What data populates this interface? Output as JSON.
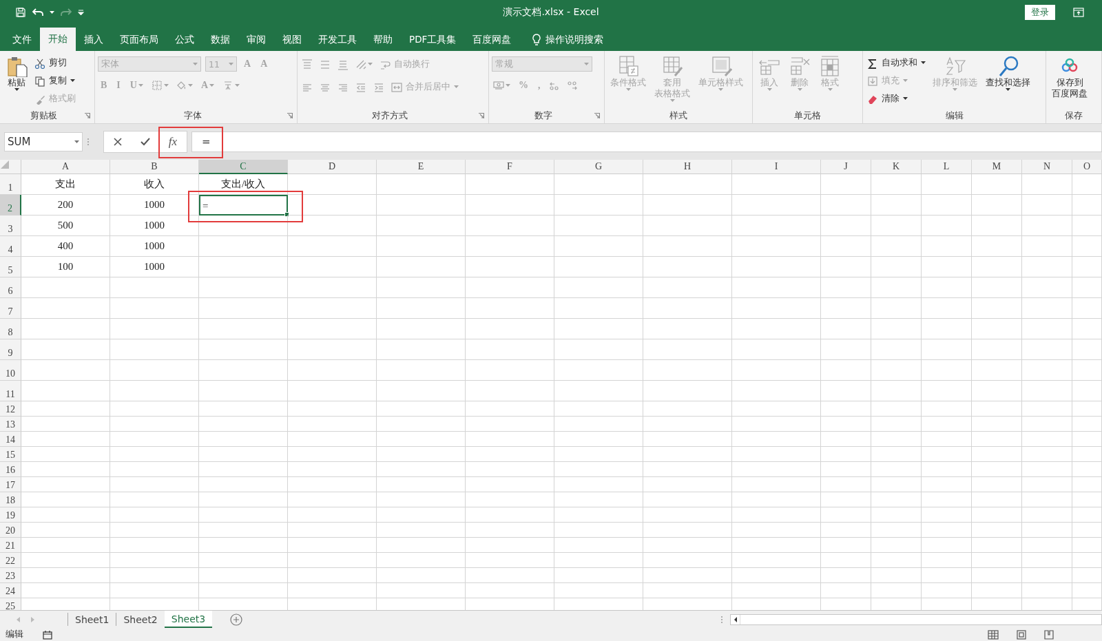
{
  "title_bar": {
    "title": "演示文档.xlsx  -  Excel",
    "login": "登录",
    "redo_disabled": true
  },
  "menu_tabs": [
    {
      "label": "文件",
      "selected": false
    },
    {
      "label": "开始",
      "selected": true
    },
    {
      "label": "插入",
      "selected": false
    },
    {
      "label": "页面布局",
      "selected": false
    },
    {
      "label": "公式",
      "selected": false
    },
    {
      "label": "数据",
      "selected": false
    },
    {
      "label": "审阅",
      "selected": false
    },
    {
      "label": "视图",
      "selected": false
    },
    {
      "label": "开发工具",
      "selected": false
    },
    {
      "label": "帮助",
      "selected": false
    },
    {
      "label": "PDF工具集",
      "selected": false
    },
    {
      "label": "百度网盘",
      "selected": false
    }
  ],
  "tell_me": "操作说明搜索",
  "ribbon_groups": [
    {
      "label": "剪贴板",
      "launcher": true,
      "columns": [
        {
          "items": [
            {
              "kind": "large",
              "lines": [
                "粘贴"
              ],
              "disabled": false,
              "dropdown": true
            }
          ]
        },
        {
          "items": [
            {
              "kind": "small",
              "label": "剪切",
              "disabled": false,
              "dropdown": false
            },
            {
              "kind": "small",
              "label": "复制",
              "disabled": false,
              "dropdown": true
            },
            {
              "kind": "small",
              "label": "格式刷",
              "disabled": true,
              "dropdown": false
            }
          ]
        }
      ]
    },
    {
      "label": "字体",
      "launcher": true,
      "rows": [
        {
          "items": [
            {
              "kind": "field",
              "label": "宋体",
              "disabled": true
            },
            {
              "kind": "field",
              "label": "11",
              "disabled": true
            },
            {
              "kind": "glyph",
              "label": "A",
              "disabled": true,
              "dropdown": false
            },
            {
              "kind": "glyph",
              "label": "A",
              "disabled": true,
              "dropdown": false
            }
          ]
        },
        {
          "items": [
            {
              "kind": "glyph",
              "label": "B",
              "disabled": true,
              "dropdown": false
            },
            {
              "kind": "glyph",
              "label": "I",
              "disabled": true,
              "dropdown": false
            },
            {
              "kind": "glyph",
              "label": "U",
              "disabled": true,
              "dropdown": true
            },
            {
              "kind": "icon",
              "disabled": true,
              "dropdown": true
            },
            {
              "kind": "icon",
              "disabled": true,
              "dropdown": true
            },
            {
              "kind": "glyph",
              "label": "A",
              "disabled": true,
              "dropdown": true
            },
            {
              "kind": "icon",
              "disabled": true,
              "dropdown": true
            }
          ]
        }
      ]
    },
    {
      "label": "对齐方式",
      "launcher": true,
      "rows": [
        {
          "items": [
            {
              "kind": "icon",
              "disabled": true,
              "dropdown": false
            },
            {
              "kind": "icon",
              "disabled": true,
              "dropdown": false
            },
            {
              "kind": "icon",
              "disabled": true,
              "dropdown": false
            },
            {
              "kind": "icon",
              "disabled": true,
              "dropdown": true
            },
            {
              "kind": "small",
              "label": "自动换行",
              "disabled": true,
              "dropdown": false
            }
          ]
        },
        {
          "items": [
            {
              "kind": "icon",
              "disabled": true,
              "dropdown": false
            },
            {
              "kind": "icon",
              "disabled": true,
              "dropdown": false
            },
            {
              "kind": "icon",
              "disabled": true,
              "dropdown": false
            },
            {
              "kind": "icon",
              "disabled": true,
              "dropdown": false
            },
            {
              "kind": "icon",
              "disabled": true,
              "dropdown": false
            },
            {
              "kind": "small",
              "label": "合并后居中",
              "disabled": true,
              "dropdown": true
            }
          ]
        }
      ]
    },
    {
      "label": "数字",
      "launcher": true,
      "rows": [
        {
          "items": [
            {
              "kind": "field",
              "label": "常规",
              "disabled": true
            }
          ]
        },
        {
          "items": [
            {
              "kind": "icon",
              "disabled": true,
              "dropdown": true
            },
            {
              "kind": "glyph",
              "label": "%",
              "disabled": true,
              "dropdown": false
            },
            {
              "kind": "glyph",
              "label": ",",
              "disabled": true,
              "dropdown": false
            },
            {
              "kind": "icon",
              "disabled": true,
              "dropdown": false
            },
            {
              "kind": "icon",
              "disabled": true,
              "dropdown": false
            }
          ]
        }
      ]
    },
    {
      "label": "样式",
      "columns": [
        {
          "items": [
            {
              "kind": "large",
              "lines": [
                "条件格式"
              ],
              "disabled": true,
              "dropdown": true
            }
          ]
        },
        {
          "items": [
            {
              "kind": "large",
              "lines": [
                "套用",
                "表格格式"
              ],
              "disabled": true,
              "dropdown": true
            }
          ]
        },
        {
          "items": [
            {
              "kind": "large",
              "lines": [
                "单元格样式"
              ],
              "disabled": true,
              "dropdown": true
            }
          ]
        }
      ]
    },
    {
      "label": "单元格",
      "columns": [
        {
          "items": [
            {
              "kind": "large",
              "lines": [
                "插入"
              ],
              "disabled": true,
              "dropdown": true
            }
          ]
        },
        {
          "items": [
            {
              "kind": "large",
              "lines": [
                "删除"
              ],
              "disabled": true,
              "dropdown": true
            }
          ]
        },
        {
          "items": [
            {
              "kind": "large",
              "lines": [
                "格式"
              ],
              "disabled": true,
              "dropdown": true
            }
          ]
        }
      ]
    },
    {
      "label": "编辑",
      "columns": [
        {
          "items": [
            {
              "kind": "small",
              "label": "自动求和",
              "disabled": false,
              "dropdown": true
            },
            {
              "kind": "small",
              "label": "填充",
              "disabled": true,
              "dropdown": true
            },
            {
              "kind": "small",
              "label": "清除",
              "disabled": false,
              "dropdown": true
            }
          ]
        },
        {
          "items": [
            {
              "kind": "large",
              "lines": [
                "排序和筛选"
              ],
              "disabled": true,
              "dropdown": true
            }
          ]
        },
        {
          "items": [
            {
              "kind": "large",
              "lines": [
                "查找和选择"
              ],
              "disabled": false,
              "dropdown": true
            }
          ]
        }
      ]
    },
    {
      "label": "保存",
      "columns": [
        {
          "items": [
            {
              "kind": "large",
              "lines": [
                "保存到",
                "百度网盘"
              ],
              "disabled": false,
              "dropdown": false
            }
          ]
        }
      ]
    }
  ],
  "formula_bar": {
    "name_box": "SUM",
    "function_button": "fx",
    "formula": "=",
    "annotated": true
  },
  "grid": {
    "columns": [
      {
        "label": "A",
        "selected": false
      },
      {
        "label": "B",
        "selected": false
      },
      {
        "label": "C",
        "selected": true
      },
      {
        "label": "D",
        "selected": false
      },
      {
        "label": "E",
        "selected": false
      },
      {
        "label": "F",
        "selected": false
      },
      {
        "label": "G",
        "selected": false
      },
      {
        "label": "H",
        "selected": false
      },
      {
        "label": "I",
        "selected": false
      },
      {
        "label": "J",
        "selected": false
      },
      {
        "label": "K",
        "selected": false
      },
      {
        "label": "L",
        "selected": false
      },
      {
        "label": "M",
        "selected": false
      },
      {
        "label": "N",
        "selected": false
      },
      {
        "label": "O",
        "selected": false
      }
    ],
    "rows": [
      {
        "header": "1",
        "selected": false,
        "cells": [
          {
            "text": "支出",
            "selected": false
          },
          {
            "text": "收入",
            "selected": false
          },
          {
            "text": "支出/收入",
            "selected": false
          }
        ]
      },
      {
        "header": "2",
        "selected": true,
        "cells": [
          {
            "text": "200",
            "selected": false
          },
          {
            "text": "1000",
            "selected": false
          },
          {
            "text": "=",
            "selected": true,
            "annotated": true
          }
        ]
      },
      {
        "header": "3",
        "selected": false,
        "cells": [
          {
            "text": "500",
            "selected": false
          },
          {
            "text": "1000",
            "selected": false
          }
        ]
      },
      {
        "header": "4",
        "selected": false,
        "cells": [
          {
            "text": "400",
            "selected": false
          },
          {
            "text": "1000",
            "selected": false
          }
        ]
      },
      {
        "header": "5",
        "selected": false,
        "cells": [
          {
            "text": "100",
            "selected": false
          },
          {
            "text": "1000",
            "selected": false
          }
        ]
      },
      {
        "header": "6",
        "selected": false
      },
      {
        "header": "7",
        "selected": false
      },
      {
        "header": "8",
        "selected": false
      },
      {
        "header": "9",
        "selected": false
      },
      {
        "header": "10",
        "selected": false
      },
      {
        "header": "11",
        "selected": false
      },
      {
        "header": "12",
        "selected": false
      },
      {
        "header": "13",
        "selected": false
      },
      {
        "header": "14",
        "selected": false
      },
      {
        "header": "15",
        "selected": false
      },
      {
        "header": "16",
        "selected": false
      },
      {
        "header": "17",
        "selected": false
      },
      {
        "header": "18",
        "selected": false
      },
      {
        "header": "19",
        "selected": false
      },
      {
        "header": "20",
        "selected": false
      },
      {
        "header": "21",
        "selected": false
      },
      {
        "header": "22",
        "selected": false
      },
      {
        "header": "23",
        "selected": false
      },
      {
        "header": "24",
        "selected": false
      },
      {
        "header": "25",
        "selected": false
      }
    ]
  },
  "sheet_tabs": [
    {
      "label": "Sheet1",
      "selected": false
    },
    {
      "label": "Sheet2",
      "selected": false
    },
    {
      "label": "Sheet3",
      "selected": true
    }
  ],
  "status_bar": {
    "mode": "编辑"
  }
}
